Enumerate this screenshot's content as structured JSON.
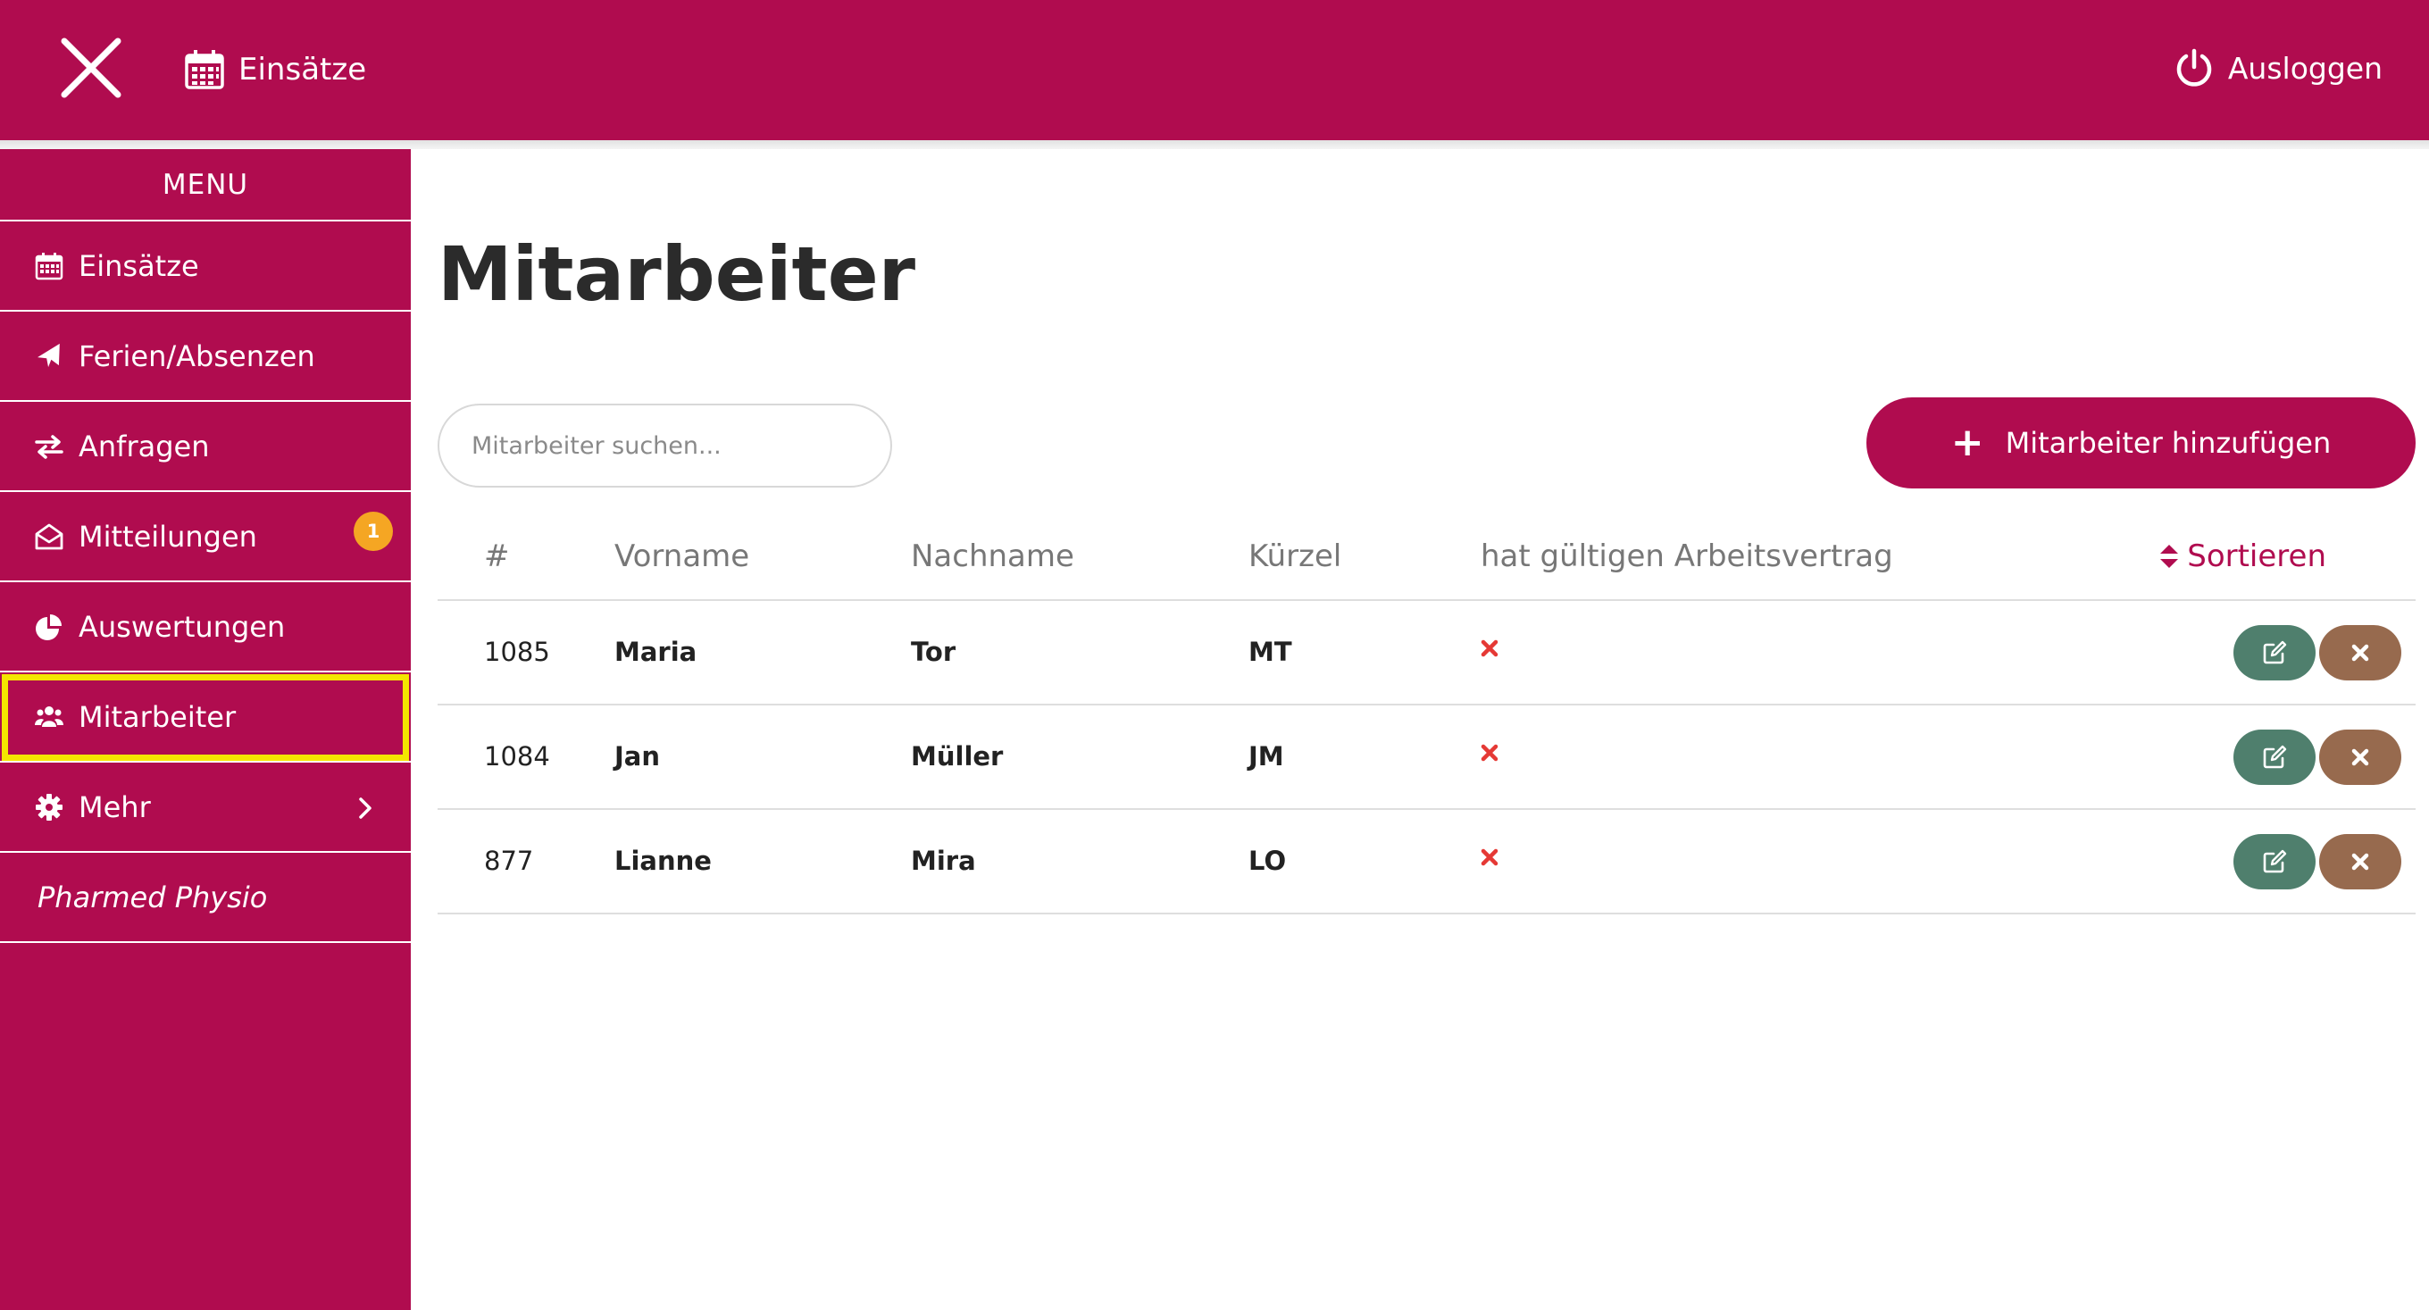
{
  "topbar": {
    "nav_label": "Einsätze",
    "logout_label": "Ausloggen"
  },
  "sidebar": {
    "menu_title": "MENU",
    "items": [
      {
        "label": "Einsätze",
        "icon": "calendar-icon"
      },
      {
        "label": "Ferien/Absenzen",
        "icon": "plane-icon"
      },
      {
        "label": "Anfragen",
        "icon": "exchange-icon"
      },
      {
        "label": "Mitteilungen",
        "icon": "envelope-open-icon",
        "badge": "1"
      },
      {
        "label": "Auswertungen",
        "icon": "pie-chart-icon"
      },
      {
        "label": "Mitarbeiter",
        "icon": "users-icon",
        "active": true
      },
      {
        "label": "Mehr",
        "icon": "gear-icon"
      },
      {
        "label": "Pharmed Physio"
      }
    ]
  },
  "main": {
    "title": "Mitarbeiter",
    "search_placeholder": "Mitarbeiter suchen...",
    "add_button_label": "Mitarbeiter hinzufügen",
    "sort_label": "Sortieren"
  },
  "table": {
    "headers": [
      "#",
      "Vorname",
      "Nachname",
      "Kürzel",
      "hat gültigen Arbeitsvertrag"
    ],
    "rows": [
      {
        "id": "1085",
        "first": "Maria",
        "last": "Tor",
        "short": "MT",
        "contract": false
      },
      {
        "id": "1084",
        "first": "Jan",
        "last": "Müller",
        "short": "JM",
        "contract": false
      },
      {
        "id": "877",
        "first": "Lianne",
        "last": "Mira",
        "short": "LO",
        "contract": false
      }
    ]
  },
  "colors": {
    "brand": "#b00c4f",
    "badge": "#f5a623",
    "edit_button": "#4f7f6d",
    "delete_button": "#976a4e",
    "no_contract_mark": "#e53935"
  }
}
